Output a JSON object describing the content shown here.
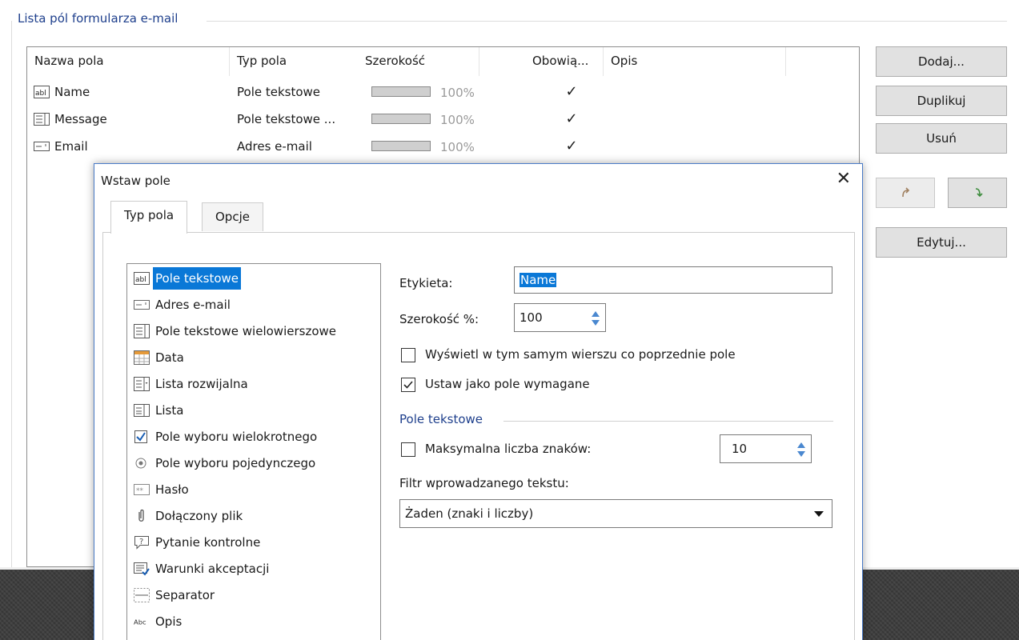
{
  "group_title": "Lista pól formularza e-mail",
  "columns": [
    "Nazwa pola",
    "Typ pola",
    "Szerokość",
    "Obowią...",
    "Opis"
  ],
  "rows": [
    {
      "icon": "textbox-icon",
      "name": "Name",
      "type": "Pole tekstowe",
      "width_pct": "100%",
      "width_value": 1.0,
      "required": "✓"
    },
    {
      "icon": "multiline-text-icon",
      "name": "Message",
      "type": "Pole tekstowe ...",
      "width_pct": "100%",
      "width_value": 1.0,
      "required": "✓"
    },
    {
      "icon": "email-field-icon",
      "name": "Email",
      "type": "Adres e-mail",
      "width_pct": "100%",
      "width_value": 1.0,
      "required": "✓"
    }
  ],
  "buttons": {
    "add": "Dodaj...",
    "duplicate": "Duplikuj",
    "delete": "Usuń",
    "move_up": "move-up-icon",
    "move_down": "move-down-icon",
    "edit": "Edytuj..."
  },
  "dialog": {
    "title": "Wstaw pole",
    "close": "✕",
    "tabs": [
      "Typ pola",
      "Opcje"
    ],
    "active_tab": "Typ pola",
    "field_types": [
      {
        "icon": "textbox-icon",
        "label": "Pole tekstowe",
        "selected": true
      },
      {
        "icon": "email-field-icon",
        "label": "Adres e-mail"
      },
      {
        "icon": "multiline-text-icon",
        "label": "Pole tekstowe wielowierszowe"
      },
      {
        "icon": "calendar-icon",
        "label": "Data"
      },
      {
        "icon": "dropdown-list-icon",
        "label": "Lista rozwijalna"
      },
      {
        "icon": "list-icon",
        "label": "Lista"
      },
      {
        "icon": "checkbox-icon",
        "label": "Pole wyboru wielokrotnego"
      },
      {
        "icon": "radio-icon",
        "label": "Pole wyboru pojedynczego"
      },
      {
        "icon": "password-icon",
        "label": "Hasło"
      },
      {
        "icon": "paperclip-icon",
        "label": "Dołączony plik"
      },
      {
        "icon": "question-bubble-icon",
        "label": "Pytanie kontrolne"
      },
      {
        "icon": "terms-icon",
        "label": "Warunki akceptacji"
      },
      {
        "icon": "separator-icon",
        "label": "Separator"
      },
      {
        "icon": "description-icon",
        "label": "Opis"
      }
    ],
    "label_caption": "Etykieta:",
    "label_value": "Name",
    "width_caption": "Szerokość %:",
    "width_value": "100",
    "same_row_caption": "Wyświetl w tym samym wierszu co poprzednie pole",
    "same_row_checked": false,
    "required_caption": "Ustaw jako pole wymagane",
    "required_checked": true,
    "section_title": "Pole tekstowe",
    "maxlen_caption": "Maksymalna liczba znaków:",
    "maxlen_checked": false,
    "maxlen_value": "10",
    "filter_caption": "Filtr wprowadzanego tekstu:",
    "filter_value": "Żaden (znaki i liczby)"
  },
  "colors": {
    "accent": "#1e3f8c",
    "selection": "#0a78d7",
    "dialog_border": "#4a7bc7"
  }
}
